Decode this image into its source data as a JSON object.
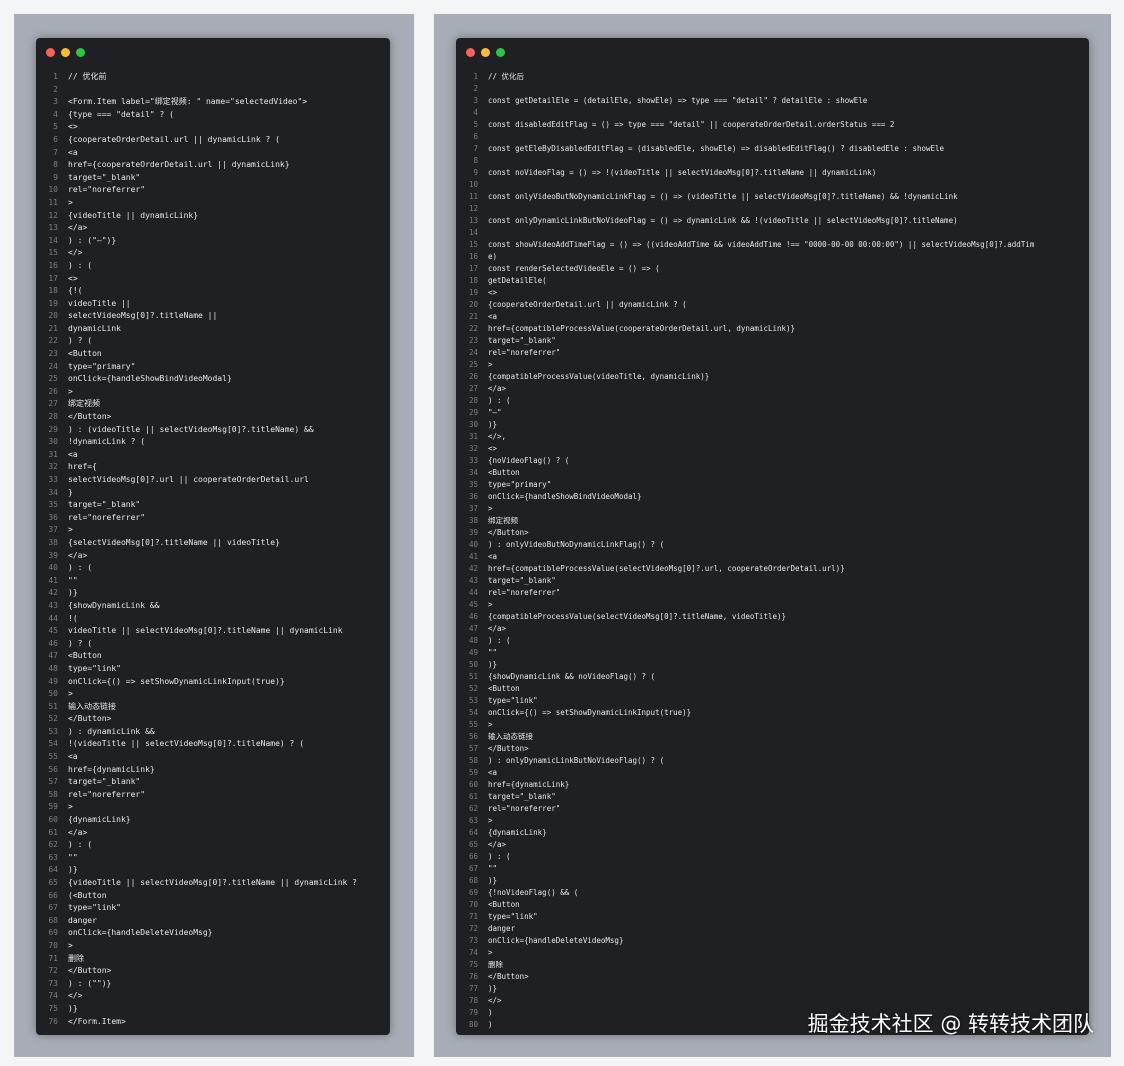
{
  "colors": {
    "editor_bg": "#1f2023",
    "line_number": "#7d7f84",
    "text": "#e8e8e8",
    "frame": "#a7adb6"
  },
  "watermark": "掘金技术社区 @ 转转技术团队",
  "before": {
    "lines": [
      "// 优化前",
      "",
      "<Form.Item label=\"绑定视频: \" name=\"selectedVideo\">",
      "{type === \"detail\" ? (",
      "<>",
      "{cooperateOrderDetail.url || dynamicLink ? (",
      "<a",
      "href={cooperateOrderDetail.url || dynamicLink}",
      "target=\"_blank\"",
      "rel=\"noreferrer\"",
      ">",
      "{videoTitle || dynamicLink}",
      "</a>",
      ") : (\"—\")}",
      "</>",
      ") : (",
      "<>",
      "{!(",
      "videoTitle ||",
      "selectVideoMsg[0]?.titleName ||",
      "dynamicLink",
      ") ? (",
      "<Button",
      "type=\"primary\"",
      "onClick={handleShowBindVideoModal}",
      ">",
      "绑定视频",
      "</Button>",
      ") : (videoTitle || selectVideoMsg[0]?.titleName) &&",
      "!dynamicLink ? (",
      "<a",
      "href={",
      "selectVideoMsg[0]?.url || cooperateOrderDetail.url",
      "}",
      "target=\"_blank\"",
      "rel=\"noreferrer\"",
      ">",
      "{selectVideoMsg[0]?.titleName || videoTitle}",
      "</a>",
      ") : (",
      "\"\"",
      ")}",
      "{showDynamicLink &&",
      "!(",
      "videoTitle || selectVideoMsg[0]?.titleName || dynamicLink",
      ") ? (",
      "<Button",
      "type=\"link\"",
      "onClick={() => setShowDynamicLinkInput(true)}",
      ">",
      "输入动态链接",
      "</Button>",
      ") : dynamicLink &&",
      "!(videoTitle || selectVideoMsg[0]?.titleName) ? (",
      "<a",
      "href={dynamicLink}",
      "target=\"_blank\"",
      "rel=\"noreferrer\"",
      ">",
      "{dynamicLink}",
      "</a>",
      ") : (",
      "\"\"",
      ")}",
      "{videoTitle || selectVideoMsg[0]?.titleName || dynamicLink ?",
      "(<Button",
      "type=\"link\"",
      "danger",
      "onClick={handleDeleteVideoMsg}",
      ">",
      "删除",
      "</Button>",
      ") : (\"\")}",
      "</>",
      ")}",
      "</Form.Item>"
    ]
  },
  "after": {
    "lines": [
      "// 优化后",
      "",
      "const getDetailEle = (detailEle, showEle) => type === \"detail\" ? detailEle : showEle",
      "",
      "const disabledEditFlag = () => type === \"detail\" || cooperateOrderDetail.orderStatus === 2",
      "",
      "const getEleByDisabledEditFlag = (disabledEle, showEle) => disabledEditFlag() ? disabledEle : showEle",
      "",
      "const noVideoFlag = () => !(videoTitle || selectVideoMsg[0]?.titleName || dynamicLink)",
      "",
      "const onlyVideoButNoDynamicLinkFlag = () => (videoTitle || selectVideoMsg[0]?.titleName) && !dynamicLink",
      "",
      "const onlyDynamicLinkButNoVideoFlag = () => dynamicLink && !(videoTitle || selectVideoMsg[0]?.titleName)",
      "",
      "const showVideoAddTimeFlag = () => ((videoAddTime && videoAddTime !== \"0000-00-00 00:00:00\") || selectVideoMsg[0]?.addTim",
      "e)",
      "const renderSelectedVideoEle = () => (",
      "getDetailEle(",
      "<>",
      "{cooperateOrderDetail.url || dynamicLink ? (",
      "<a",
      "href={compatibleProcessValue(cooperateOrderDetail.url, dynamicLink)}",
      "target=\"_blank\"",
      "rel=\"noreferrer\"",
      ">",
      "{compatibleProcessValue(videoTitle, dynamicLink)}",
      "</a>",
      ") : (",
      "\"—\"",
      ")}",
      "</>,",
      "<>",
      "{noVideoFlag() ? (",
      "<Button",
      "type=\"primary\"",
      "onClick={handleShowBindVideoModal}",
      ">",
      "绑定视频",
      "</Button>",
      ") : onlyVideoButNoDynamicLinkFlag() ? (",
      "<a",
      "href={compatibleProcessValue(selectVideoMsg[0]?.url, cooperateOrderDetail.url)}",
      "target=\"_blank\"",
      "rel=\"noreferrer\"",
      ">",
      "{compatibleProcessValue(selectVideoMsg[0]?.titleName, videoTitle)}",
      "</a>",
      ") : (",
      "\"\"",
      ")}",
      "{showDynamicLink && noVideoFlag() ? (",
      "<Button",
      "type=\"link\"",
      "onClick={() => setShowDynamicLinkInput(true)}",
      ">",
      "输入动态链接",
      "</Button>",
      ") : onlyDynamicLinkButNoVideoFlag() ? (",
      "<a",
      "href={dynamicLink}",
      "target=\"_blank\"",
      "rel=\"noreferrer\"",
      ">",
      "{dynamicLink}",
      "</a>",
      ") : (",
      "\"\"",
      ")}",
      "{!noVideoFlag() && (",
      "<Button",
      "type=\"link\"",
      "danger",
      "onClick={handleDeleteVideoMsg}",
      ">",
      "删除",
      "</Button>",
      ")}",
      "</>",
      ")",
      ")"
    ]
  }
}
